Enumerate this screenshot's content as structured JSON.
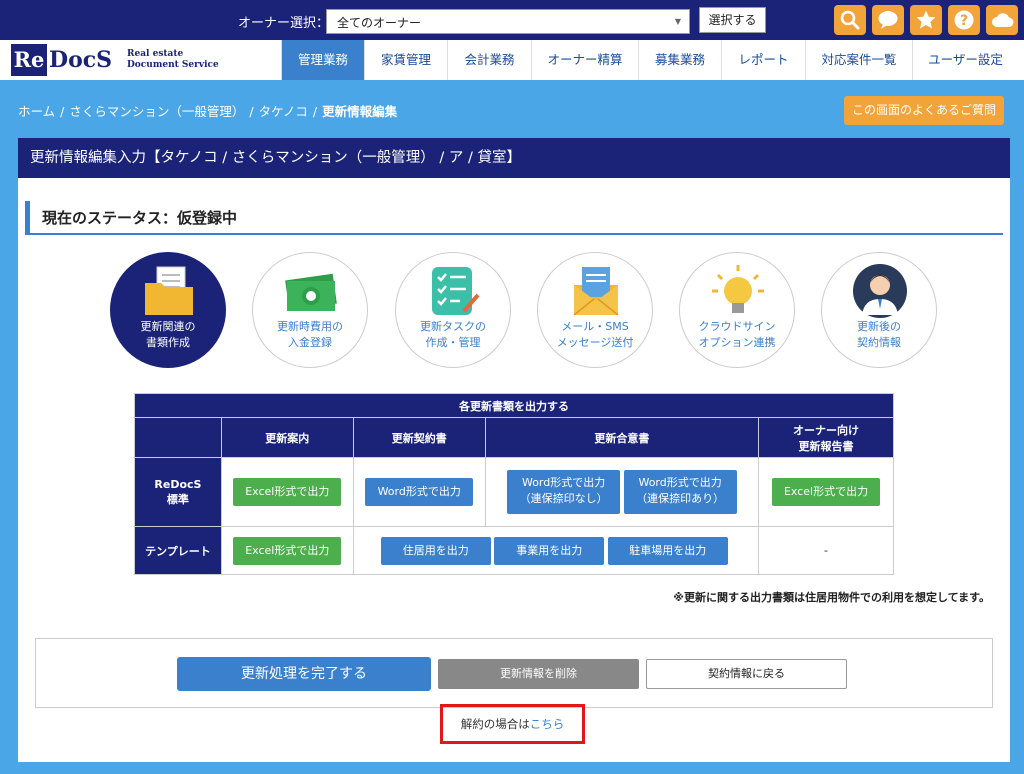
{
  "header": {
    "owner_label": "オーナー選択：",
    "owner_value": "全てのオーナー",
    "select_button": "選択する",
    "icons": [
      "search-icon",
      "chat-icon",
      "star-icon",
      "help-icon",
      "cloud-icon"
    ]
  },
  "logo": {
    "re": "Re",
    "docs": "DocS",
    "line1": "Real estate",
    "line2": "Document Service"
  },
  "nav": [
    "管理業務",
    "家賃管理",
    "会計業務",
    "オーナー精算",
    "募集業務",
    "レポート",
    "対応案件一覧",
    "ユーザー設定"
  ],
  "breadcrumb": {
    "home": "ホーム",
    "property": "さくらマンション（一般管理）",
    "tenant": "タケノコ",
    "current": "更新情報編集",
    "sep": "/"
  },
  "faq_button": "この画面のよくあるご質問",
  "panel_title": "更新情報編集入力【タケノコ / さくらマンション（一般管理） / ア / 貸室】",
  "status_title": "現在のステータス：仮登録中",
  "steps": [
    {
      "line1": "更新関連の",
      "line2": "書類作成"
    },
    {
      "line1": "更新時費用の",
      "line2": "入金登録"
    },
    {
      "line1": "更新タスクの",
      "line2": "作成・管理"
    },
    {
      "line1": "メール・SMS",
      "line2": "メッセージ送付"
    },
    {
      "line1": "クラウドサイン",
      "line2": "オプション連携"
    },
    {
      "line1": "更新後の",
      "line2": "契約情報"
    }
  ],
  "table": {
    "title": "各更新書類を出力する",
    "col_guide": "更新案内",
    "col_contract": "更新契約書",
    "col_agreement": "更新合意書",
    "col_owner_l1": "オーナー向け",
    "col_owner_l2": "更新報告書",
    "row1_l1": "ReDocS",
    "row1_l2": "標準",
    "row2": "テンプレート",
    "excel": "Excel形式で出力",
    "word": "Word形式で出力",
    "word_no_seal_l1": "Word形式で出力",
    "word_no_seal_l2": "（連保捺印なし）",
    "word_seal_l1": "Word形式で出力",
    "word_seal_l2": "（連保捺印あり）",
    "residential": "住居用を出力",
    "business": "事業用を出力",
    "parking": "駐車場用を出力",
    "dash": "-"
  },
  "note": "※更新に関する出力書類は住居用物件での利用を想定してます。",
  "actions": {
    "complete": "更新処理を完了する",
    "delete": "更新情報を削除",
    "back": "契約情報に戻る"
  },
  "cancel": {
    "text": "解約の場合は",
    "link": "こちら"
  },
  "colors": {
    "navy": "#1a2378",
    "blue": "#3a80cc",
    "green": "#4cae4c",
    "orange": "#f2a33a",
    "bg": "#4aa6e6",
    "red": "#e01818"
  }
}
